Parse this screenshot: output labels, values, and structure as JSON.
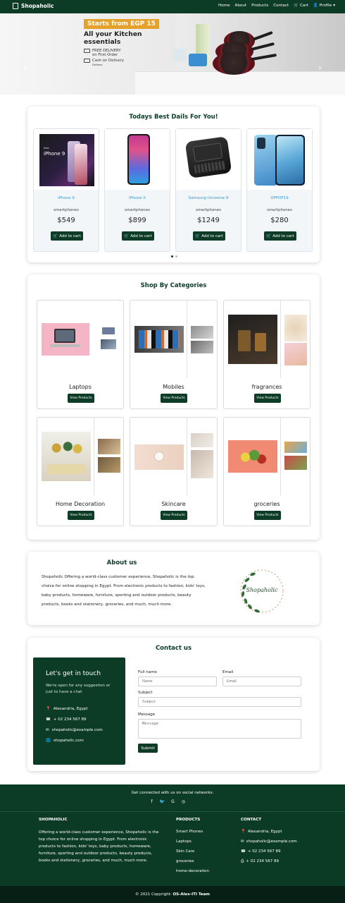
{
  "nav": {
    "brand": "Shopaholic",
    "links": [
      "Home",
      "About",
      "Products",
      "Contact",
      "Cart",
      "Profile"
    ]
  },
  "hero": {
    "badge": "Starts from EGP 15",
    "headline": "All your Kitchen essentials",
    "feature1_a": "FREE DELIVERY",
    "feature1_b": "on First Order",
    "feature2_a": "Cash on Delivery",
    "feature2_b": "Delivery",
    "prev": "‹",
    "next": "›"
  },
  "deals": {
    "title": "Todays Best Dails For You!",
    "add_label": "Add to cart",
    "products": [
      {
        "name": "iPhone 9",
        "category": "smartphones",
        "price": "$549"
      },
      {
        "name": "iPhone X",
        "category": "smartphones",
        "price": "$899"
      },
      {
        "name": "Samsung Universe 9",
        "category": "smartphones",
        "price": "$1249"
      },
      {
        "name": "OPPOF19",
        "category": "smartphones",
        "price": "$280"
      }
    ],
    "image_text_iphone9": "iPhone 9",
    "image_text_new": "New"
  },
  "categories": {
    "title": "Shop By Categories",
    "button_label": "View Products",
    "items": [
      "Laptops",
      "Mobiles",
      "fragrances",
      "Home Decoration",
      "Skincare",
      "groceries"
    ]
  },
  "about": {
    "title": "About us",
    "text": "Shopaholic Offering a world-class customer experience, Shopaholic is the top choice for online shopping in Egypt. From electronic products to fashion, kids' toys, baby products, homeware, furniture, sporting and outdoor products, beauty products, books and stationery, groceries, and much, much more.",
    "logo_text": "Shopaholic"
  },
  "contact": {
    "title": "Contact us",
    "box_title": "Let's get in touch",
    "box_subtitle": "We're open for any suggestion or just to have a chat",
    "address": "Alexandria, Egypt",
    "phone": "+ 02 234 567 89",
    "email": "shopaholic@example.com",
    "website": "shopaholic.com",
    "full_name_label": "Full name",
    "full_name_placeholder": "Name",
    "email_label": "Email",
    "email_placeholder": "Email",
    "subject_label": "Subject",
    "subject_placeholder": "Subject",
    "message_label": "Message",
    "message_placeholder": "Message",
    "submit_label": "Submit"
  },
  "footer": {
    "social_text": "Get connected with us on social networks:",
    "col1_title": "SHOPAHOLIC",
    "col1_text": "Offering a world-class customer experience, Shopaholic is the top choice for online shopping in Egypt. From electronic products to fashion, kids' toys, baby products, homeware, furniture, sporting and outdoor products, beauty products, books and stationery, groceries, and much, much more.",
    "col2_title": "PRODUCTS",
    "col2_links": [
      "Smart Phones",
      "Laptops",
      "Skin Care",
      "groceries",
      "home-decoration"
    ],
    "col3_title": "CONTACT",
    "col3_address": "Alexandria, Egypt",
    "col3_email": "shopaholic@example.com",
    "col3_phone1": "+ 02 234 567 89",
    "col3_phone2": "+ 02 234 567 89",
    "copyright_prefix": "© 2021 Copyright: ",
    "copyright_team": "OS-Alex-ITI Team"
  },
  "colors": {
    "brand_green": "#0c3b26",
    "accent_orange": "#e6a12a",
    "link_blue": "#2a9bd8"
  }
}
